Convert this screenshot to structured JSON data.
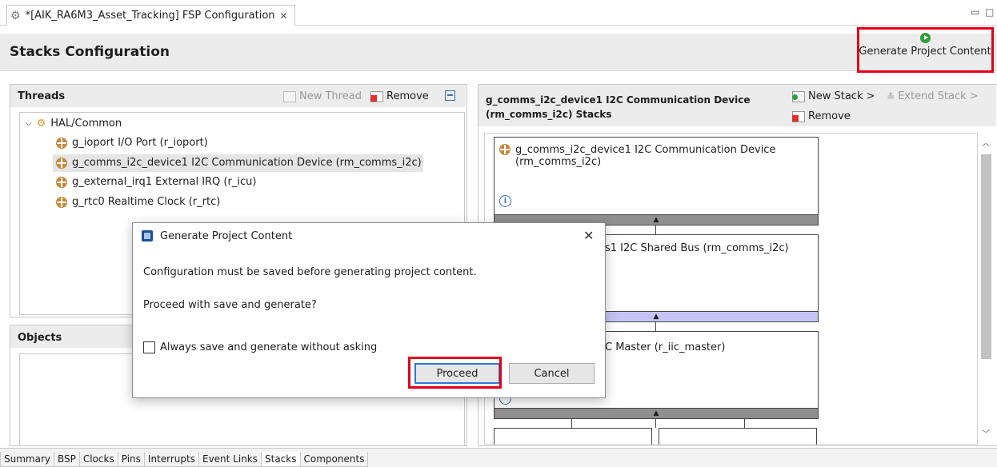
{
  "editor_tab": {
    "title": "*[AIK_RA6M3_Asset_Tracking] FSP Configuration",
    "close": "✕"
  },
  "window_controls": {
    "minimize": "▭",
    "maximize": "□"
  },
  "header": {
    "title": "Stacks Configuration",
    "generate_label": "Generate Project Content"
  },
  "threads": {
    "title": "Threads",
    "new_thread": "New Thread",
    "remove": "Remove",
    "root": "HAL/Common",
    "items": [
      "g_ioport I/O Port (r_ioport)",
      "g_comms_i2c_device1 I2C Communication Device (rm_comms_i2c)",
      "g_external_irq1 External IRQ (r_icu)",
      "g_rtc0 Realtime Clock (r_rtc)"
    ]
  },
  "objects": {
    "title": "Objects"
  },
  "stacks": {
    "title_line1": "g_comms_i2c_device1 I2C Communication Device",
    "title_line2": "(rm_comms_i2c) Stacks",
    "new_stack": "New Stack >",
    "extend_stack": "Extend Stack >",
    "remove": "Remove",
    "box1_line1": "g_comms_i2c_device1 I2C Communication Device",
    "box1_line2": "(rm_comms_i2c)",
    "box2_text": "s1 I2C Shared Bus (rm_comms_i2c)",
    "box3_text": "C Master (r_iic_master)"
  },
  "dialog": {
    "title": "Generate Project Content",
    "close": "✕",
    "message": "Configuration must be saved before generating project content.",
    "question": "Proceed with save and generate?",
    "checkbox_label": "Always save and generate without asking",
    "checkbox_checked": false,
    "proceed": "Proceed",
    "cancel": "Cancel"
  },
  "bottom_tabs": [
    "Summary",
    "BSP",
    "Clocks",
    "Pins",
    "Interrupts",
    "Event Links",
    "Stacks",
    "Components"
  ],
  "active_bottom_tab": "Stacks",
  "colors": {
    "highlight": "#e0001b",
    "accent_green": "#2e9e3a",
    "selection": "#e5e5e5",
    "bar_blue": "#c5c5f5"
  }
}
